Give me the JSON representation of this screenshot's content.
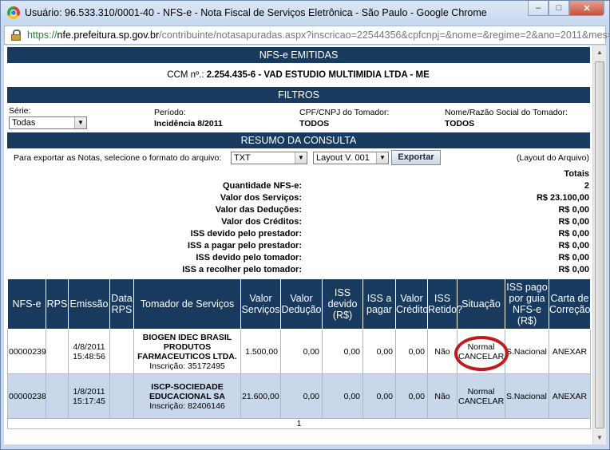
{
  "window": {
    "title": "Usuário: 96.533.310/0001-40 - NFS-e - Nota Fiscal de Serviços Eletrônica - São Paulo - Google Chrome",
    "buttons": {
      "minimize": "–",
      "maximize": "□",
      "close": "✕"
    }
  },
  "address_bar": {
    "scheme": "https://",
    "host": "nfe.prefeitura.sp.gov.br",
    "path": "/contribuinte/notasapuradas.aspx?inscricao=22544356&cpfcnpj=&nome=&regime=2&ano=2011&mes="
  },
  "page": {
    "header_title": "NFS-e EMITIDAS",
    "ccm_label": "CCM nº.:",
    "ccm_value": "2.254.435-6 - VAD ESTUDIO MULTIMIDIA LTDA - ME",
    "filters_title": "FILTROS",
    "serie_label": "Série:",
    "serie_value": "Todas",
    "periodo_label": "Período:",
    "periodo_value": "Incidência 8/2011",
    "cpf_label": "CPF/CNPJ do Tomador:",
    "cpf_value": "TODOS",
    "nome_label": "Nome/Razão Social do Tomador:",
    "nome_value": "TODOS",
    "resumo_title": "RESUMO DA CONSULTA",
    "export_text": "Para exportar as Notas, selecione o formato do arquivo:",
    "format_value": "TXT",
    "layout_value": "Layout V. 001",
    "export_button": "Exportar",
    "layout_link": "(Layout do Arquivo)",
    "totais_label": "Totais"
  },
  "summary": [
    {
      "label": "Quantidade NFS-e:",
      "value": "2"
    },
    {
      "label": "Valor dos Serviços:",
      "value": "R$ 23.100,00"
    },
    {
      "label": "Valor das Deduções:",
      "value": "R$ 0,00"
    },
    {
      "label": "Valor dos Créditos:",
      "value": "R$ 0,00"
    },
    {
      "label": "ISS devido pelo prestador:",
      "value": "R$ 0,00"
    },
    {
      "label": "ISS a pagar pelo prestador:",
      "value": "R$ 0,00"
    },
    {
      "label": "ISS devido pelo tomador:",
      "value": "R$ 0,00"
    },
    {
      "label": "ISS a recolher pelo tomador:",
      "value": "R$ 0,00"
    }
  ],
  "table": {
    "headers": [
      "NFS-e",
      "RPS",
      "Emissão",
      "Data RPS",
      "Tomador de Serviços",
      "Valor Serviços",
      "Valor Dedução",
      "ISS devido (R$)",
      "ISS a pagar",
      "Valor Crédito",
      "ISS Retido?",
      "Situação",
      "ISS pago por guia NFS-e (R$)",
      "Carta de Correção"
    ],
    "rows": [
      {
        "nfse": "00000239",
        "rps": "",
        "emissao_date": "4/8/2011",
        "emissao_time": "15:48:56",
        "data_rps": "",
        "tomador_name": "BIOGEN IDEC BRASIL PRODUTOS FARMACEUTICOS LTDA.",
        "tomador_insc": "Inscrição: 35172495",
        "valor_servicos": "1.500,00",
        "valor_deducao": "0,00",
        "iss_devido": "0,00",
        "iss_pagar": "0,00",
        "valor_credito": "0,00",
        "iss_retido": "Não",
        "situacao": "Normal",
        "cancelar": "CANCELAR",
        "iss_guia": "S.Nacional",
        "carta": "ANEXAR"
      },
      {
        "nfse": "00000238",
        "rps": "",
        "emissao_date": "1/8/2011",
        "emissao_time": "15:17:45",
        "data_rps": "",
        "tomador_name": "ISCP-SOCIEDADE EDUCACIONAL SA",
        "tomador_insc": "Inscrição: 82406146",
        "valor_servicos": "21.600,00",
        "valor_deducao": "0,00",
        "iss_devido": "0,00",
        "iss_pagar": "0,00",
        "valor_credito": "0,00",
        "iss_retido": "Não",
        "situacao": "Normal",
        "cancelar": "CANCELAR",
        "iss_guia": "S.Nacional",
        "carta": "ANEXAR"
      }
    ],
    "page_number": "1"
  },
  "colors": {
    "band": "#173a5e",
    "alt_row": "#c8d7ea",
    "highlight_circle": "#c21a1a"
  }
}
